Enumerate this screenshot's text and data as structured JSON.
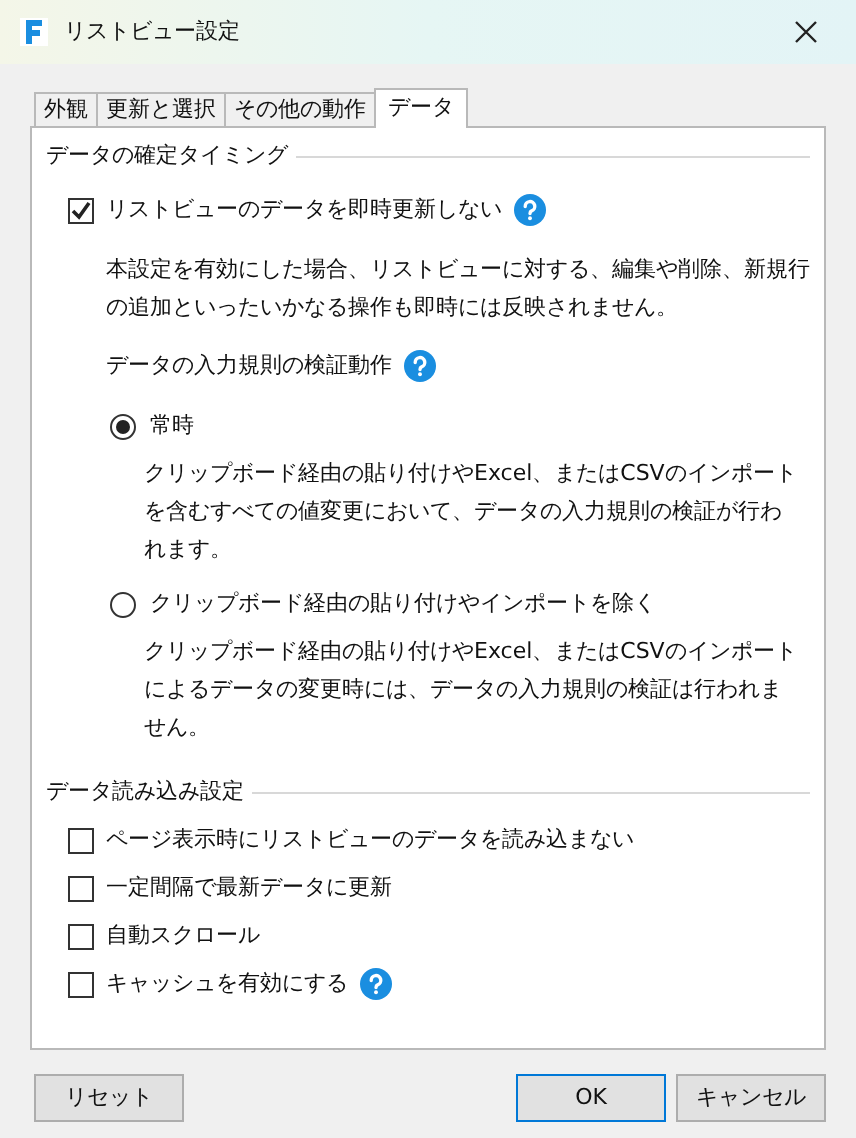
{
  "window": {
    "title": "リストビュー設定"
  },
  "tabs": [
    {
      "label": "外観",
      "selected": false
    },
    {
      "label": "更新と選択",
      "selected": false
    },
    {
      "label": "その他の動作",
      "selected": false
    },
    {
      "label": "データ",
      "selected": true
    }
  ],
  "sections": [
    {
      "title": "データの確定タイミング",
      "items": [
        {
          "kind": "checkbox",
          "label": "リストビューのデータを即時更新しない",
          "checked": true,
          "help": true,
          "note": "本設定を有効にした場合、リストビューに対する、編集や削除、新規行の追加といったいかなる操作も即時には反映されません。"
        },
        {
          "kind": "heading",
          "label": "データの入力規則の検証動作",
          "help": true
        },
        {
          "kind": "radio",
          "label": "常時",
          "selected": true,
          "note": "クリップボード経由の貼り付けやExcel、またはCSVのインポートを含むすべての値変更において、データの入力規則の検証が行われます。"
        },
        {
          "kind": "radio",
          "label": "クリップボード経由の貼り付けやインポートを除く",
          "selected": false,
          "note": "クリップボード経由の貼り付けやExcel、またはCSVのインポートによるデータの変更時には、データの入力規則の検証は行われません。"
        }
      ]
    },
    {
      "title": "データ読み込み設定",
      "items": [
        {
          "kind": "checkbox",
          "label": "ページ表示時にリストビューのデータを読み込まない",
          "checked": false,
          "help": false
        },
        {
          "kind": "checkbox",
          "label": "一定間隔で最新データに更新",
          "checked": false,
          "help": false
        },
        {
          "kind": "checkbox",
          "label": "自動スクロール",
          "checked": false,
          "help": false
        },
        {
          "kind": "checkbox",
          "label": "キャッシュを有効にする",
          "checked": false,
          "help": true
        }
      ]
    }
  ],
  "reset_button": {
    "label": "リセット"
  },
  "buttons": [
    {
      "label": "OK",
      "default": true
    },
    {
      "label": "キャンセル",
      "default": false
    }
  ]
}
